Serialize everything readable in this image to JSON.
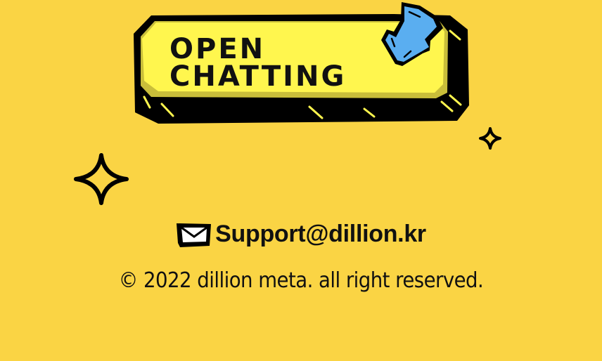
{
  "button": {
    "line1": "OPEN",
    "line2": "CHATTING"
  },
  "contact": {
    "email": "Support@dillion.kr",
    "icon": "envelope-icon"
  },
  "footer": {
    "copyright": "© 2022 dillion meta. all right reserved."
  },
  "colors": {
    "background": "#FAD444",
    "button_face": "#FFF64E",
    "arrow": "#5AAEF0"
  }
}
